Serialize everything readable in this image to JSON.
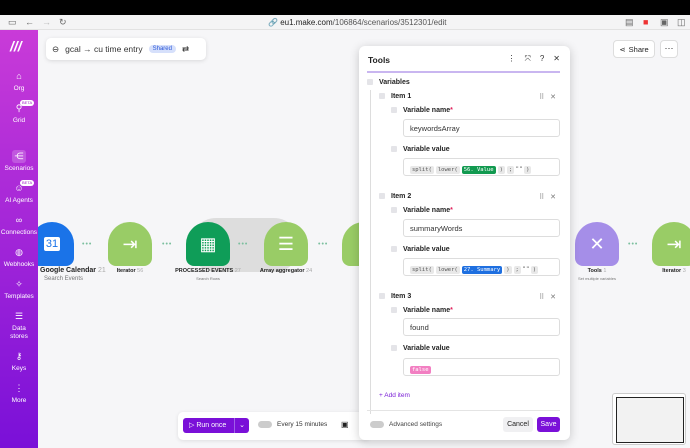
{
  "browser": {
    "url_domain": "eu1.make.com",
    "url_path": "/106864/scenarios/3512301/edit"
  },
  "sidebar": {
    "items": [
      {
        "label": "Org",
        "icon": "home-icon"
      },
      {
        "label": "Grid",
        "icon": "grid-icon",
        "badge": "BETA"
      },
      {
        "label": "Scenarios",
        "icon": "share-icon",
        "active": true
      },
      {
        "label": "AI Agents",
        "icon": "ai-agent-icon",
        "badge": "BETA"
      },
      {
        "label": "Connections",
        "icon": "link-icon"
      },
      {
        "label": "Webhooks",
        "icon": "globe-icon"
      },
      {
        "label": "Templates",
        "icon": "puzzle-icon"
      },
      {
        "label": "Data stores",
        "icon": "database-icon"
      },
      {
        "label": "Keys",
        "icon": "key-icon"
      },
      {
        "label": "More",
        "icon": "more-vertical-icon"
      }
    ]
  },
  "scenario": {
    "title": "gcal → cu time entry",
    "shared": "Shared",
    "share_button": "Share",
    "more_button": "···"
  },
  "modules": [
    {
      "label": "Google Calendar",
      "id": "21",
      "sub": "Search Events",
      "color": "#1a73e8"
    },
    {
      "label": "Iterator",
      "id": "56",
      "sub": "",
      "color": "#99cc66"
    },
    {
      "label": "PROCESSED EVENTS",
      "id": "27",
      "sub": "Search Rows",
      "color": "#0f9d58"
    },
    {
      "label": "Array aggregator",
      "id": "24",
      "sub": "",
      "color": "#99cc66"
    },
    {
      "label": "Tools",
      "id": "1",
      "sub": "Set multiple variables",
      "color": "#a58ee8"
    },
    {
      "label": "Iterator",
      "id": "3",
      "sub": "",
      "color": "#99cc66"
    }
  ],
  "panel": {
    "title": "Tools",
    "section": "Variables",
    "items": [
      {
        "label": "Item 1",
        "name_label": "Variable name",
        "name": "keywordsArray",
        "value_label": "Variable value",
        "tokens": [
          "split(",
          "lower(",
          "56. Value",
          ")",
          ";",
          "\" \"",
          ")"
        ],
        "pill": "56. Value",
        "pill_color": "#129a50"
      },
      {
        "label": "Item 2",
        "name_label": "Variable name",
        "name": "summaryWords",
        "value_label": "Variable value",
        "tokens": [
          "split(",
          "lower(",
          "27. Summary",
          ")",
          ";",
          "\" \"",
          ")"
        ],
        "pill": "27. Summary",
        "pill_color": "#1e6fe0"
      },
      {
        "label": "Item 3",
        "name_label": "Variable name",
        "name": "found",
        "value_label": "Variable value",
        "tokens": [
          "false"
        ],
        "pill": "false",
        "pill_color": "#f27fc2"
      }
    ],
    "add_item": "+ Add item",
    "advanced": "Advanced settings",
    "cancel": "Cancel",
    "save": "Save"
  },
  "toolbar": {
    "run_once": "Run once",
    "schedule": "Every 15 minutes"
  }
}
